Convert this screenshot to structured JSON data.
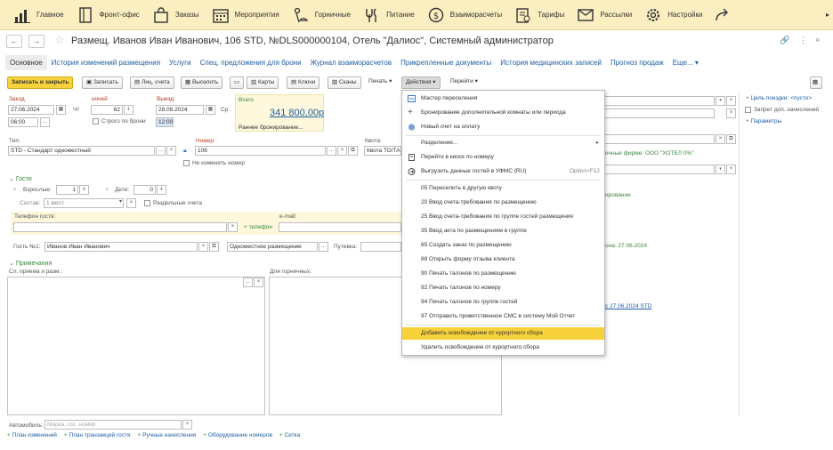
{
  "nav": {
    "items": [
      {
        "icon": "bar-chart-icon",
        "label": "Главное"
      },
      {
        "icon": "front-desk-icon",
        "label": "Фронт-офис"
      },
      {
        "icon": "shopping-bag-icon",
        "label": "Заказы"
      },
      {
        "icon": "calendar-icon",
        "label": "Мероприятия"
      },
      {
        "icon": "housekeeping-icon",
        "label": "Горничные"
      },
      {
        "icon": "food-icon",
        "label": "Питание"
      },
      {
        "icon": "settlements-icon",
        "label": "Взаиморасчеты"
      },
      {
        "icon": "tariffs-icon",
        "label": "Тарифы"
      },
      {
        "icon": "mail-icon",
        "label": "Рассылки"
      },
      {
        "icon": "settings-icon",
        "label": "Настройки"
      }
    ]
  },
  "title": {
    "text": "Размещ. Иванов Иван Иванович, 106 STD, №DLS000000104, Отель \"Далиос\", Системный администратор",
    "back": "←",
    "forward": "→",
    "star": "☆",
    "link": "🔗",
    "more": "⋮",
    "close": "×"
  },
  "tabs": [
    "Основное",
    "История изменений размещения",
    "Услуги",
    "Спец. предложения для брони",
    "Журнал взаиморасчетов",
    "Прикрепленные документы",
    "История медицинских записей",
    "Прогноз продаж",
    "Еще..."
  ],
  "toolbar": {
    "save_close": "Записать и закрыть",
    "save": "Записать",
    "account": "Лиц. счета",
    "checkout": "Выселить",
    "cards": "Карты",
    "keys": "Ключи",
    "scans": "Сканы",
    "print": "Печать",
    "actions": "Действия",
    "goto": "Перейти"
  },
  "form": {
    "checkin_label": "Заезд",
    "checkin_date": "27.06.2024",
    "checkin_day": "Чт",
    "checkin_time": "06:00",
    "nights_label": "ночей",
    "nights": "62",
    "strict_label": "Строго по брони",
    "checkout_label": "Выезд",
    "checkout_date": "28.08.2024",
    "checkout_day": "Ср",
    "checkout_time": "12:00",
    "total_label": "Всего",
    "total": "341 800,00р",
    "early": "Раннее бронирование...",
    "type_label": "Тип:",
    "type_value": "STD - Стандарт одноместный",
    "number_label": "Номер:",
    "number_value": "106",
    "keep_number": "Не изменять номер",
    "quota_label": "Квота:",
    "quota_value": "Квота ТО/ТА",
    "guests_section": "Гости",
    "adults_label": "Взрослые:",
    "adults": "1",
    "children_label": "Дети:",
    "children": "0",
    "composition_label": "Состав:",
    "composition": "1 мест.",
    "separate": "Раздельные счета",
    "phone_label": "Телефон гостя:",
    "add_phone": "+ телефон",
    "email_label": "e-mail:",
    "guest1_label": "Гость №1:",
    "guest1": "Иванов Иван Иванович",
    "placement": "Одноместное размещение",
    "voucher_label": "Путевка:",
    "notes_section": "Примечания",
    "reception_label": "Сл. приема и разм.:",
    "maid_label": "Для горничных:",
    "car_label": "Автомобиль:",
    "car_placeholder": "Марка, гос. номер"
  },
  "right": {
    "trip_goal": "Цель поездки: <пусто>",
    "ban_label": "Запрет доп. начислений",
    "params": "Параметры",
    "firm_text": "ичные фирме: ООО \"ХОТЕЛ 0%\"",
    "booking_text": "ирование",
    "date_text": "она: 27.06.2024",
    "link_text": "с 27.06.2024 STD"
  },
  "menu": {
    "items": [
      {
        "icon": "resettle-icon",
        "label": "Мастер переселения"
      },
      {
        "icon": "plus-icon",
        "label": "Бронирование дополнительной комнаты или периода"
      },
      {
        "icon": "invoice-icon",
        "label": "Новый счет на оплату"
      },
      {
        "label": "Разделение..."
      },
      {
        "icon": "kiosk-icon",
        "label": "Перейти в киоск по номеру"
      },
      {
        "icon": "export-icon",
        "label": "Выгрузить данные гостей в УФМС (RU)",
        "shortcut": "Option+F12"
      },
      {
        "label": "05 Переселить в другую квоту"
      },
      {
        "label": "20 Ввод счета-требования по размещению"
      },
      {
        "label": "25 Ввод счета-требования по группе гостей размещения"
      },
      {
        "label": "35 Ввод акта по размещениям в группе"
      },
      {
        "label": "65 Создать заказ по размещению"
      },
      {
        "label": "88 Открыть форму отзыва клиента"
      },
      {
        "label": "90 Печать талонов по размещению"
      },
      {
        "label": "92 Печать талонов по номеру"
      },
      {
        "label": "94 Печать талонов по группе гостей"
      },
      {
        "label": "97 Отправить приветственное СМС в систему Мой Отчет"
      },
      {
        "label": "Добавить освобождение от курортного сбора"
      },
      {
        "label": "Удалить освобождение от курортного сбора"
      }
    ]
  },
  "bottom": [
    "План изменений",
    "План транзакций гостя",
    "Ручные начисления",
    "Оборудование номеров",
    "Сетка"
  ],
  "colors": {
    "accent": "#f7d13a",
    "link": "#1d5fa5",
    "nav_bg": "#fbeec1",
    "section": "#3a8a3a"
  }
}
